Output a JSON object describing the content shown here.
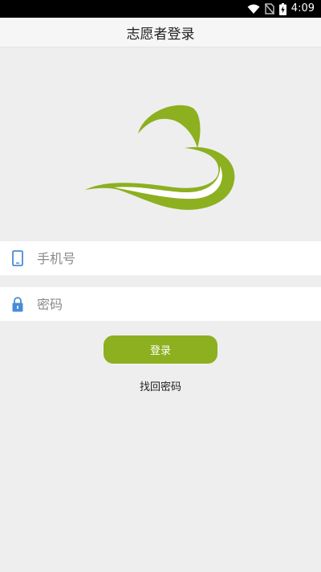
{
  "status_bar": {
    "time": "4:09",
    "icons": [
      "wifi-icon",
      "no-sim-icon",
      "battery-charging-icon"
    ]
  },
  "header": {
    "title": "志愿者登录"
  },
  "logo": {
    "icon": "logo-icon",
    "color": "#8cb01f"
  },
  "form": {
    "phone": {
      "icon": "phone-icon",
      "placeholder": "手机号",
      "value": ""
    },
    "password": {
      "icon": "lock-icon",
      "placeholder": "密码",
      "value": ""
    },
    "login_button": {
      "label": "登录",
      "color": "#8cb01f"
    },
    "forgot_password_label": "找回密码"
  },
  "colors": {
    "accent": "#8cb01f",
    "field_icon": "#4a8bd8",
    "background": "#eeeeee"
  }
}
